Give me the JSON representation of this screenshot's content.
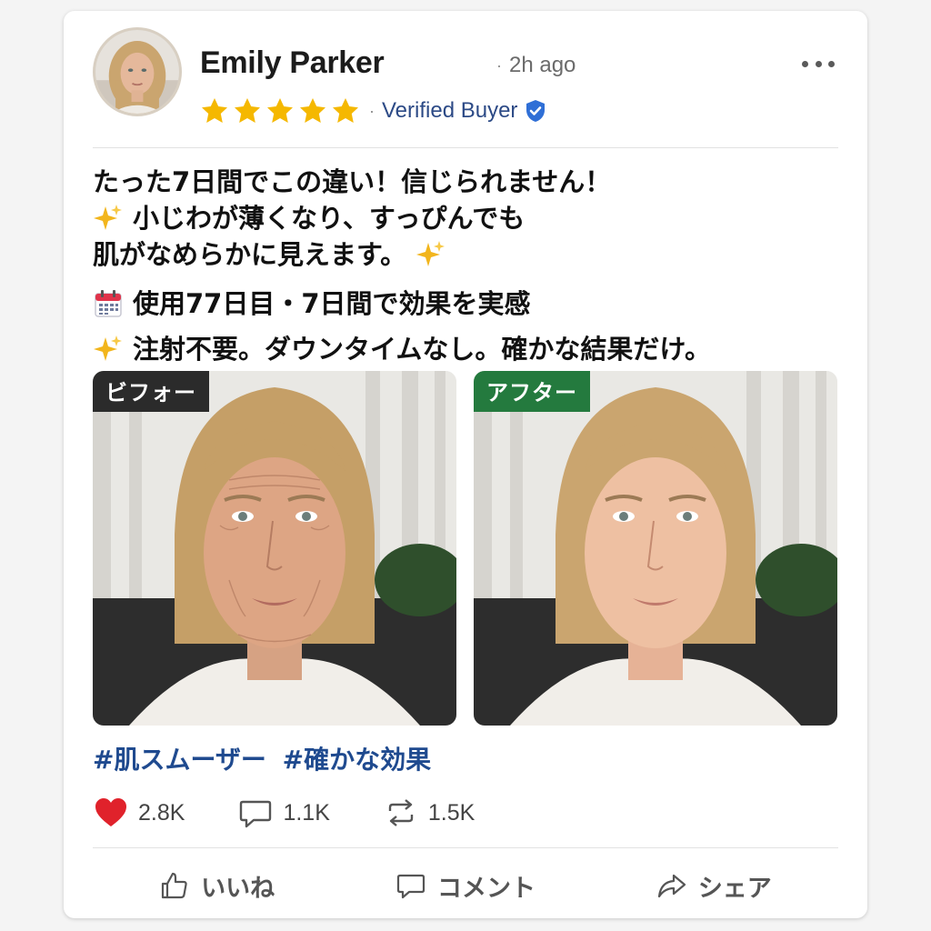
{
  "post": {
    "author_name": "Emily Parker",
    "separator": "·",
    "time_ago": "2h ago",
    "rating": 5,
    "badge_text": "Verified Buyer",
    "body_lines": [
      "たった7日間でこの違い！信じられません！",
      "小じわが薄くなり、すっぴんでも",
      "肌がなめらかに見えます。"
    ],
    "detail_day": "使用77日目・7日間で効果を実感",
    "detail_note": "注射不要。ダウンタイムなし。確かな結果だけ。",
    "images": {
      "before_label": "ビフォー",
      "after_label": "アフター"
    },
    "hashtags": [
      "#肌スムーザー",
      "#確かな効果"
    ],
    "stats": {
      "likes": "2.8K",
      "comments": "1.1K",
      "shares": "1.5K"
    },
    "actions": {
      "like": "いいね",
      "comment": "コメント",
      "share": "シェア"
    }
  },
  "colors": {
    "star": "#f5b800",
    "badge_blue": "#2f6fd6",
    "before_tag": "#2b2b2b",
    "after_tag": "#247a3e",
    "hashtag": "#1f4a8f",
    "heart": "#e0222b"
  },
  "icons": {
    "more": "ellipsis-icon",
    "badge": "shield-check-icon",
    "sparkle": "sparkles-icon",
    "calendar": "calendar-icon",
    "heart": "heart-icon",
    "comment": "comment-bubble-icon",
    "repost": "repost-icon",
    "like_action": "thumbs-up-icon",
    "comment_action": "comment-bubble-icon",
    "share_action": "share-arrow-icon"
  }
}
